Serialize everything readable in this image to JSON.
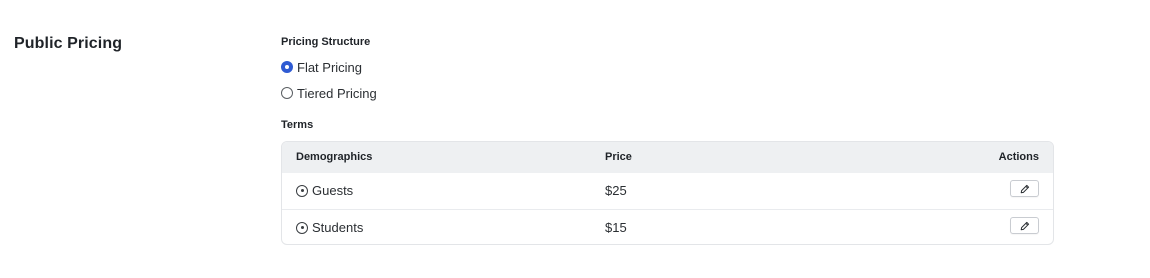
{
  "section": {
    "title": "Public Pricing"
  },
  "pricing_structure": {
    "label": "Pricing Structure",
    "options": [
      {
        "label": "Flat Pricing",
        "selected": true
      },
      {
        "label": "Tiered Pricing",
        "selected": false
      }
    ]
  },
  "terms": {
    "label": "Terms",
    "columns": {
      "demographics": "Demographics",
      "price": "Price",
      "actions": "Actions"
    },
    "rows": [
      {
        "demographic": "Guests",
        "price": "$25",
        "icon": "target-icon",
        "action_icon": "pencil-icon"
      },
      {
        "demographic": "Students",
        "price": "$15",
        "icon": "target-icon",
        "action_icon": "pencil-icon"
      }
    ]
  },
  "colors": {
    "accent": "#2f5bd3",
    "header_bg": "#eef0f2",
    "border": "#e3e5e8"
  }
}
